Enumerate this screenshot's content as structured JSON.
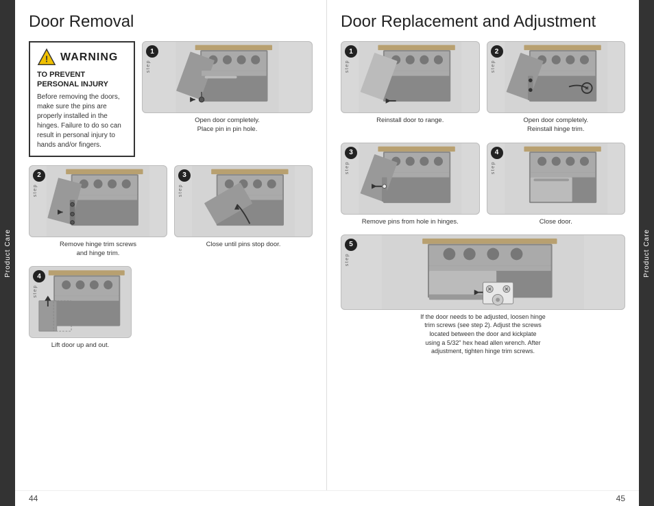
{
  "page": {
    "left_title": "Door Removal",
    "right_title": "Door Replacement and Adjustment",
    "page_left": "44",
    "page_right": "45",
    "side_tab_label": "Product Care"
  },
  "warning": {
    "title": "WARNING",
    "subtitle": "TO PREVENT\nPERSONAL INJURY",
    "body": "Before removing the doors, make sure the pins are properly installed in the hinges. Failure to do so can result in personal injury to hands and/or fingers."
  },
  "left_steps": [
    {
      "number": "1",
      "caption": "Open door completely.\nPlace pin in pin hole."
    },
    {
      "number": "2",
      "caption": "Remove hinge trim screws\nand hinge trim."
    },
    {
      "number": "3",
      "caption": "Close until pins stop door."
    },
    {
      "number": "4",
      "caption": "Lift door up and out."
    }
  ],
  "right_steps": [
    {
      "number": "1",
      "caption": "Reinstall door to range."
    },
    {
      "number": "2",
      "caption": "Open door completely.\nReinstall hinge trim."
    },
    {
      "number": "3",
      "caption": "Remove pins from hole in hinges."
    },
    {
      "number": "4",
      "caption": "Close door."
    },
    {
      "number": "5",
      "caption": "If the door needs to be adjusted, loosen hinge trim screws (see step 2). Adjust the screws located between the door and kickplate using a 5/32\" hex head allen wrench. After adjustment, tighten hinge trim screws."
    }
  ],
  "step_word": "step"
}
